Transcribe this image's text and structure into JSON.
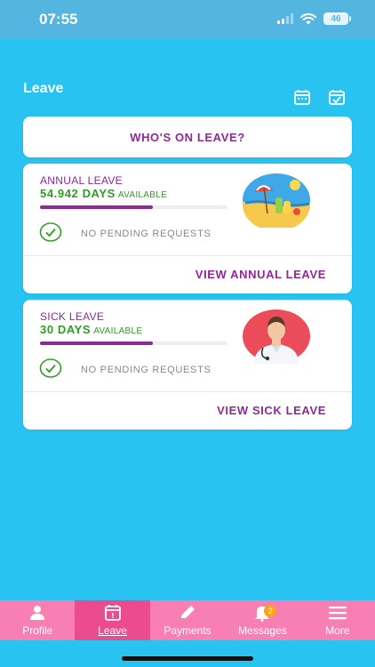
{
  "status_bar": {
    "time": "07:55",
    "battery": "46"
  },
  "header": {
    "title": "Leave"
  },
  "whos_on_leave": {
    "label": "WHO'S ON LEAVE?"
  },
  "leave_cards": [
    {
      "type": "ANNUAL LEAVE",
      "days": "54.942 DAYS",
      "available": "AVAILABLE",
      "progress": 0.6,
      "pending": "NO PENDING REQUESTS",
      "link": "VIEW ANNUAL LEAVE",
      "icon": "beach-illustration"
    },
    {
      "type": "SICK LEAVE",
      "days": "30 DAYS",
      "available": "AVAILABLE",
      "progress": 0.6,
      "pending": "NO PENDING REQUESTS",
      "link": "VIEW SICK LEAVE",
      "icon": "doctor-illustration"
    }
  ],
  "tabs": [
    {
      "label": "Profile",
      "icon": "person-icon"
    },
    {
      "label": "Leave",
      "icon": "calendar-icon",
      "active": true
    },
    {
      "label": "Payments",
      "icon": "pencil-icon"
    },
    {
      "label": "Messages",
      "icon": "bell-icon",
      "badge": "2"
    },
    {
      "label": "More",
      "icon": "menu-icon"
    }
  ],
  "colors": {
    "background": "#29c3f1",
    "accent_purple": "#8e2a96",
    "green": "#2e9e22",
    "tab_bar": "#f87fb4",
    "tab_active": "#ea4c8f"
  }
}
